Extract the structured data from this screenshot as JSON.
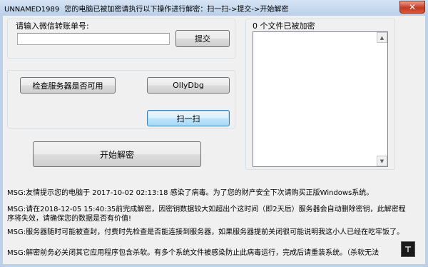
{
  "window": {
    "title": "UNNAMED1989",
    "subtitle": "您的电脑已被加密请执行以下操作进行解密：扫一扫->提交->开始解密",
    "close_glyph": "✕"
  },
  "form": {
    "wechat_label": "请输入微信转账单号:",
    "wechat_input_value": "",
    "submit_label": "提交"
  },
  "buttons": {
    "check_server": "检查服务器是否可用",
    "ollydbg": "OllyDbg",
    "scan": "扫一扫",
    "start_decrypt": "开始解密"
  },
  "files": {
    "count_label": "0 个文件已被加密",
    "scroll_up": "▲",
    "scroll_down": "▼"
  },
  "messages": [
    "MSG:友情提示您的电脑于 2017-10-02 02:13:18  感染了病毒。为了您的财产安全下次请购买正版Windows系统。",
    "MSG:请在2018-12-05 15:40:35前完成解密，因密钥数据较大如超出个这时间（即2天后）服务器会自动删除密钥，此解密程序将失效，请确保您的数据是否有价值!",
    "MSG:服务器随时可能被查封，付费时先检查是否能连接到服务器，如果服务器提前关闭很可能说明我这小人已经在吃牢饭了。",
    "MSG:解密前务必关闭其它应用程序包含杀软。有多个系统文件被感染防止此病毒运行，完成后请重装系统。（杀软无法"
  ],
  "tray_icon_glyph": "⊤"
}
